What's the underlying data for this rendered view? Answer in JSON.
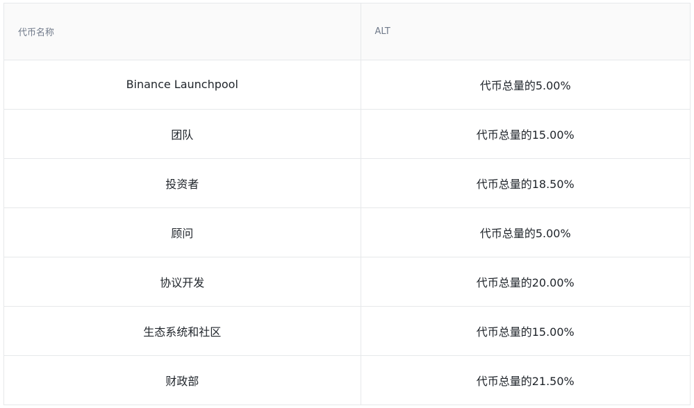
{
  "table": {
    "headers": [
      "代币名称",
      "ALT"
    ],
    "rows": [
      [
        "Binance Launchpool",
        "代币总量的5.00%"
      ],
      [
        "团队",
        "代币总量的15.00%"
      ],
      [
        "投资者",
        "代币总量的18.50%"
      ],
      [
        "顾问",
        "代币总量的5.00%"
      ],
      [
        "协议开发",
        "代币总量的20.00%"
      ],
      [
        "生态系统和社区",
        "代币总量的15.00%"
      ],
      [
        "财政部",
        "代币总量的21.50%"
      ]
    ]
  },
  "colors": {
    "border": "#e6e8ea",
    "header_bg": "#fafafa",
    "header_text": "#707a8a",
    "cell_text": "#1e2329"
  }
}
